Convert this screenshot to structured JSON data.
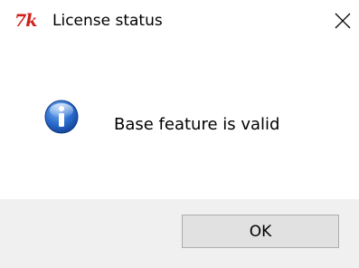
{
  "window": {
    "title": "License status",
    "app_icon_glyph": "7k",
    "app_icon_name": "tk-feather-icon",
    "close_icon_name": "close-icon"
  },
  "message": {
    "icon_name": "info-icon",
    "text": "Base feature is valid"
  },
  "footer": {
    "ok_label": "OK"
  },
  "colors": {
    "app_icon": "#d0201c",
    "footer_background": "#f0f0f0",
    "button_background": "#e1e1e1",
    "button_border": "#adadad",
    "info_icon": "#1f5fbf"
  }
}
